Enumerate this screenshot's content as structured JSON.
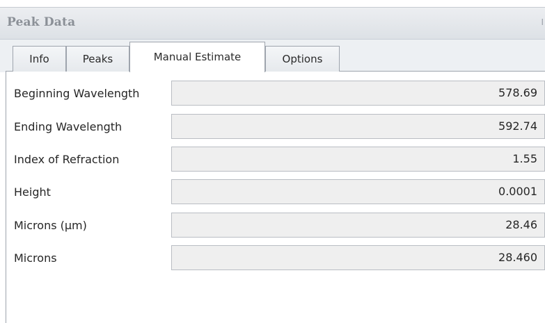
{
  "panel": {
    "title": "Peak Data",
    "pin_glyph": "I"
  },
  "tabs": [
    {
      "label": "Info",
      "active": false
    },
    {
      "label": "Peaks",
      "active": false
    },
    {
      "label": "Manual Estimate",
      "active": true
    },
    {
      "label": "Options",
      "active": false
    }
  ],
  "fields": [
    {
      "label": "Beginning Wavelength",
      "value": "578.69"
    },
    {
      "label": "Ending Wavelength",
      "value": "592.74"
    },
    {
      "label": "Index of Refraction",
      "value": "1.55"
    },
    {
      "label": "Height",
      "value": "0.0001"
    },
    {
      "label": "Microns (µm)",
      "value": "28.46"
    },
    {
      "label": "Microns",
      "value": "28.460"
    }
  ],
  "colors": {
    "field_background": "#efefef",
    "field_border": "#b9bdc3",
    "title_text": "#8b9097"
  }
}
